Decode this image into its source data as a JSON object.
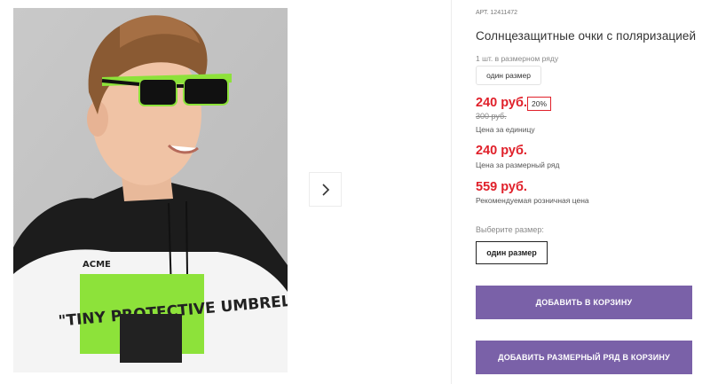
{
  "product": {
    "article": "АРТ. 12411472",
    "title": "Солнцезащитные очки с поляризацией",
    "qty_in_row": "1 шт. в размерном ряду",
    "size_pill": "один размер",
    "price": "240 руб.",
    "discount": "20%",
    "old_price": "300 руб.",
    "price_caption": "Цена за единицу",
    "row_price": "240 руб.",
    "row_price_caption": "Цена за размерный ряд",
    "retail_price": "559 руб.",
    "retail_caption": "Рекомендуемая розничная цена",
    "choose_size_label": "Выберите размер:",
    "size_option": "один размер"
  },
  "actions": {
    "add_to_cart": "ДОБАВИТЬ В КОРЗИНУ",
    "add_row_to_cart": "ДОБАВИТЬ РАЗМЕРНЫЙ РЯД В КОРЗИНУ"
  },
  "gallery": {
    "shirt_text": "\"TINY PROTECTIVE UMBRELLA\"",
    "brand_text": "ACME",
    "icons": {
      "next": "chevron-right-icon"
    }
  },
  "colors": {
    "accent_purple": "#7a61a8",
    "price_red": "#e0202a",
    "lime": "#8de23a"
  }
}
